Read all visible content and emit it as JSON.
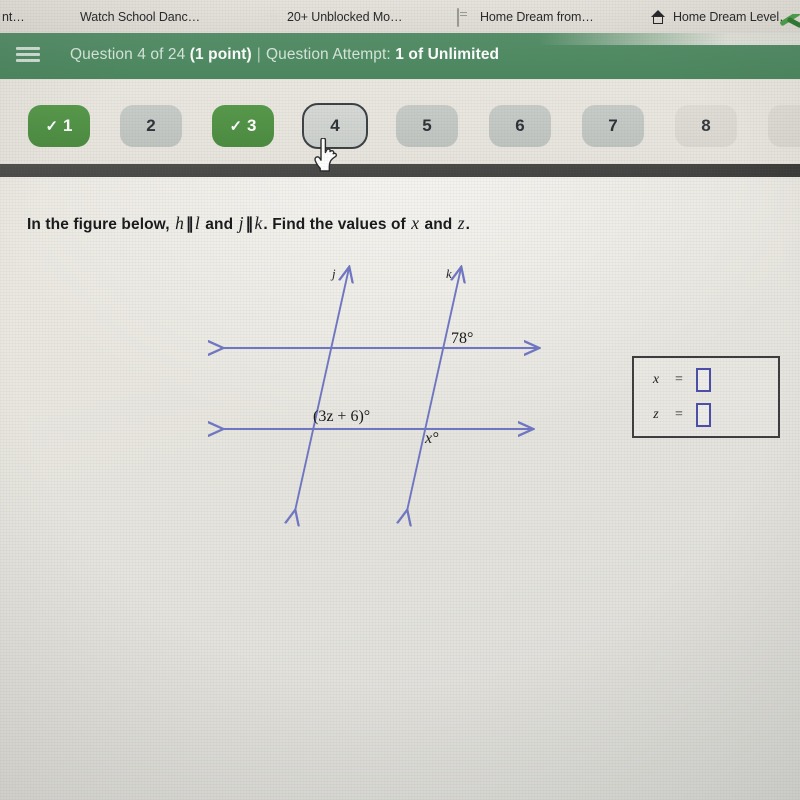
{
  "browser": {
    "tabs": [
      {
        "title": "nt…",
        "icon": "none-icon"
      },
      {
        "title": "Watch School Danc…",
        "icon": "dark-square-favicon"
      },
      {
        "title": "20+ Unblocked Mo…",
        "icon": "globe-favicon"
      },
      {
        "title": "Home Dream from…",
        "icon": "card-favicon"
      },
      {
        "title": "Home Dream Level…",
        "icon": "house-favicon"
      }
    ]
  },
  "header": {
    "menu_icon": "hamburger-icon",
    "question_progress_prefix": "Question 4 of 24 ",
    "question_points": "(1 point)",
    "separator": "|",
    "attempt_prefix": "Question Attempt: ",
    "attempt_value": "1 of Unlimited",
    "background_color": "#4e8a62"
  },
  "question_nav": {
    "items": [
      {
        "label": "1",
        "state": "done",
        "check": "✓"
      },
      {
        "label": "2",
        "state": "plain",
        "check": ""
      },
      {
        "label": "3",
        "state": "done",
        "check": "✓"
      },
      {
        "label": "4",
        "state": "current",
        "check": ""
      },
      {
        "label": "5",
        "state": "plain",
        "check": ""
      },
      {
        "label": "6",
        "state": "plain",
        "check": ""
      },
      {
        "label": "7",
        "state": "plain",
        "check": ""
      },
      {
        "label": "8",
        "state": "faded",
        "check": ""
      }
    ],
    "done_color": "#4a8a3f",
    "plain_color": "#c2c6c4",
    "current_outline_color": "#3a3f44"
  },
  "cursor": {
    "type": "pointer-hand-cursor",
    "over": "4"
  },
  "question": {
    "text_part1": "In the figure below, ",
    "line_h": "h",
    "parallel_symbol_1": "∥",
    "line_l": "l",
    "text_and": " and ",
    "line_j": "j",
    "parallel_symbol_2": "∥",
    "line_k": "k",
    "text_part2": ". Find the values of ",
    "var_x": "x",
    "text_and2": " and ",
    "var_z": "z",
    "text_period": "."
  },
  "figure": {
    "label_j": "j",
    "label_k": "k",
    "angle_78": "78°",
    "angle_3z6": "(3z + 6)°",
    "angle_x": "x°",
    "line_color": "#6f76c4"
  },
  "answer_box": {
    "rows": [
      {
        "variable": "x",
        "equals": "=",
        "value": ""
      },
      {
        "variable": "z",
        "equals": "=",
        "value": ""
      }
    ],
    "input_border_color": "#4a4ea8",
    "box_border_color": "#3c3c3f"
  }
}
